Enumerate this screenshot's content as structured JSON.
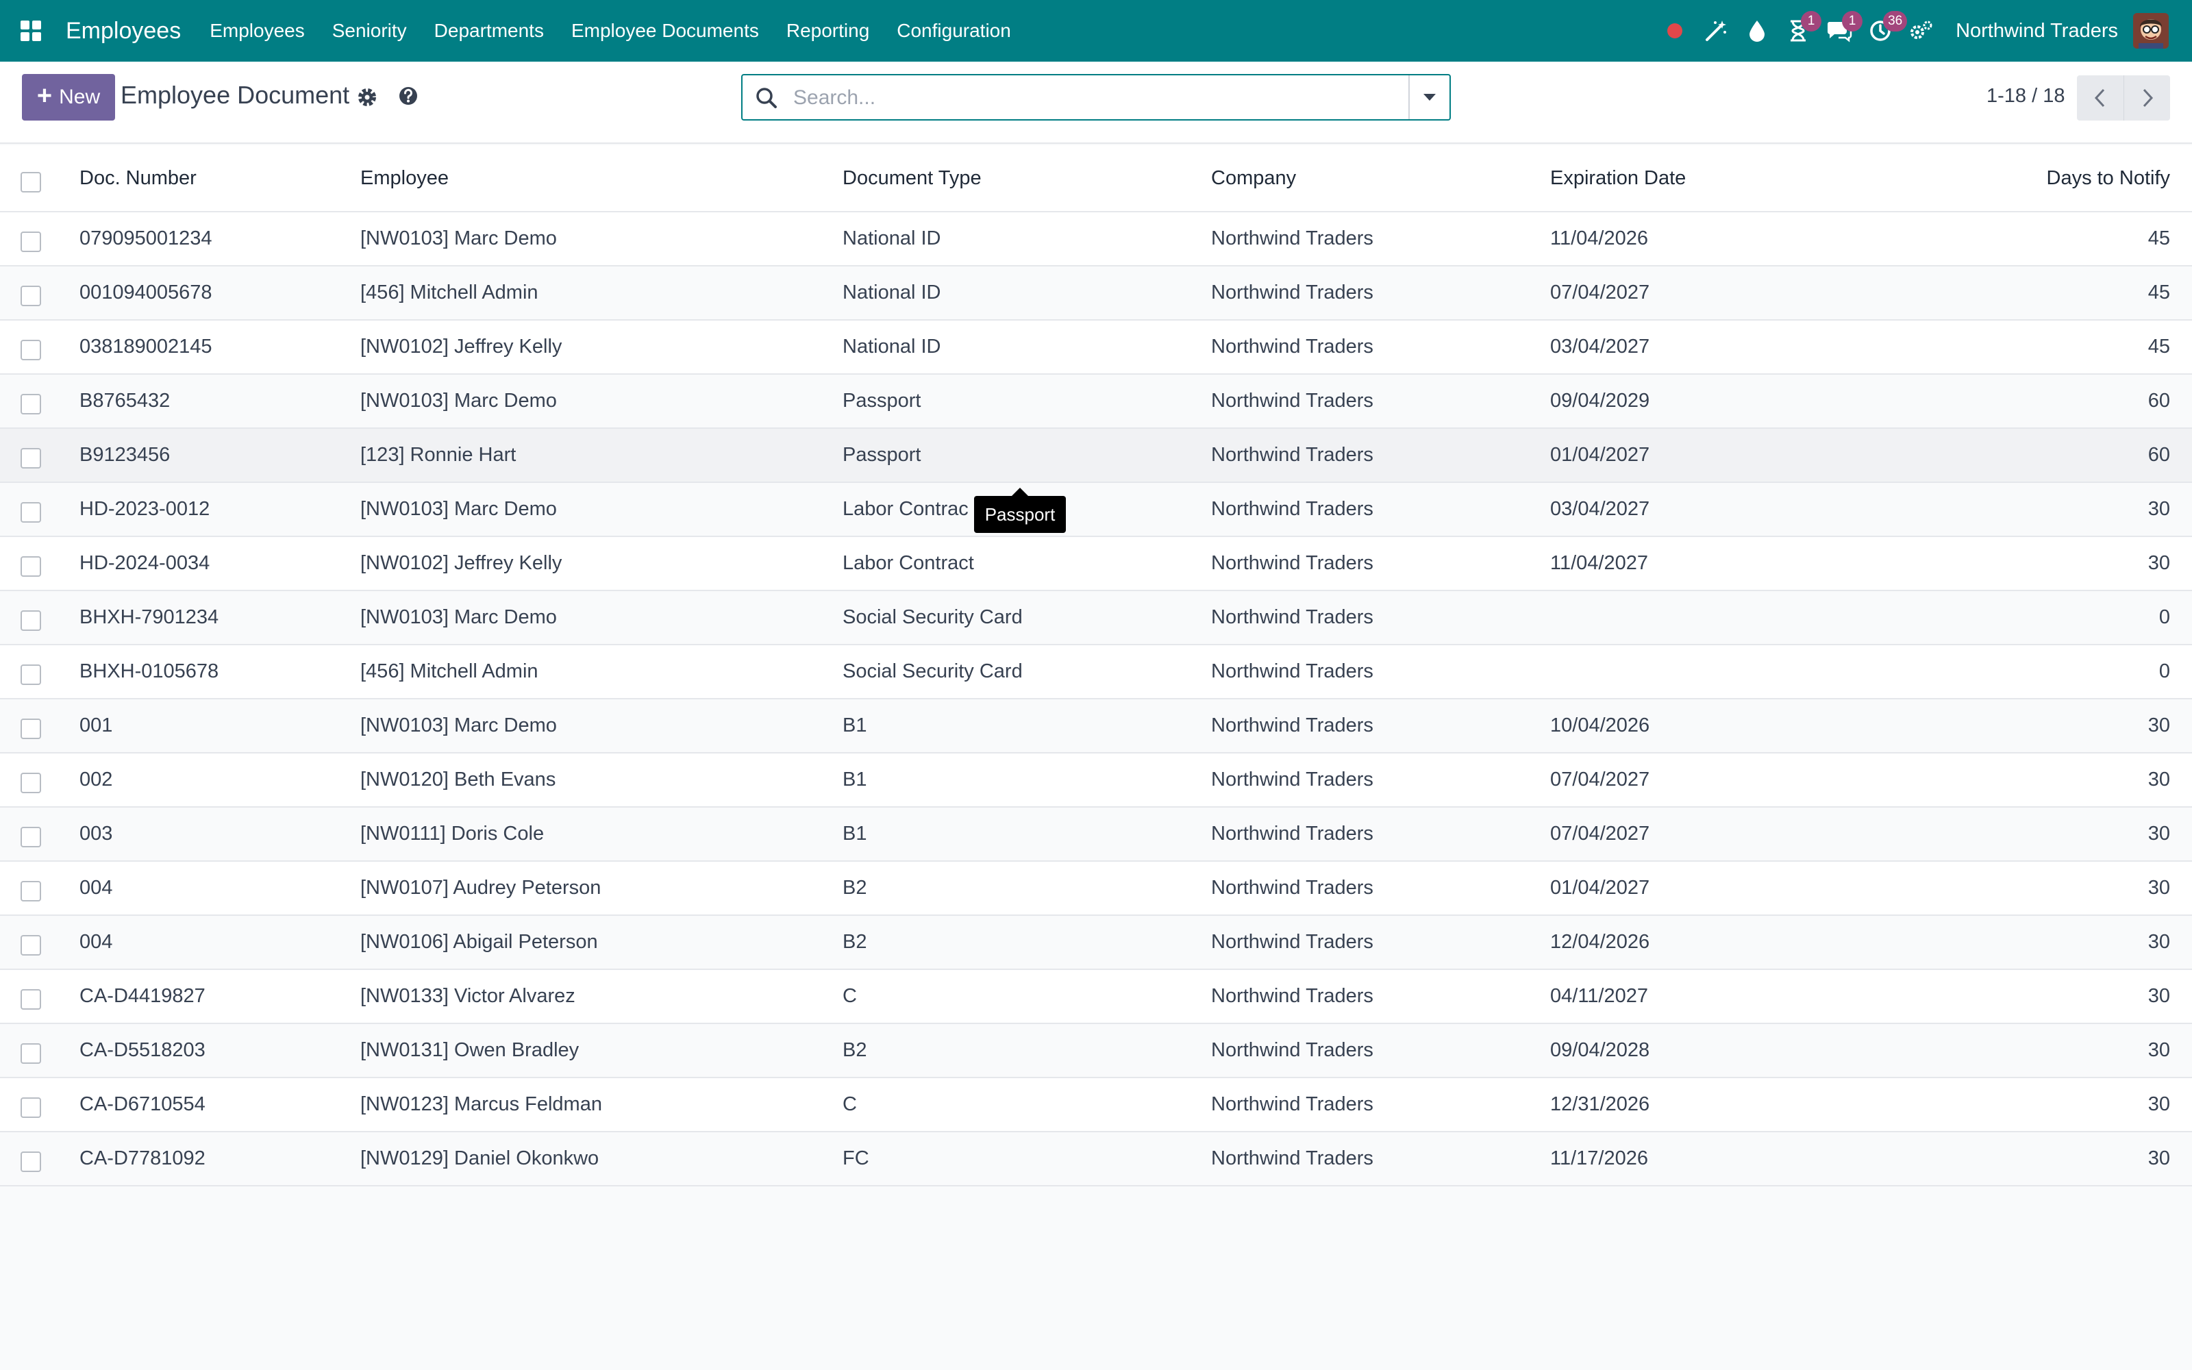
{
  "navbar": {
    "brand": "Employees",
    "menu": [
      "Employees",
      "Seniority",
      "Departments",
      "Employee Documents",
      "Reporting",
      "Configuration"
    ],
    "activities_count": "1",
    "messages_count": "1",
    "clock_count": "36",
    "company": "Northwind Traders",
    "colors": {
      "bar": "#017e84",
      "badge": "#a2457c",
      "recording_dot": "#e2474a"
    }
  },
  "control_panel": {
    "new_label": "New",
    "title": "Employee Document",
    "search_placeholder": "Search...",
    "pager": "1-18 / 18"
  },
  "table": {
    "columns": [
      "Doc. Number",
      "Employee",
      "Document Type",
      "Company",
      "Expiration Date",
      "Days to Notify"
    ],
    "rows": [
      {
        "doc": "079095001234",
        "employee": "[NW0103] Marc Demo",
        "type": "National ID",
        "company": "Northwind Traders",
        "expiration": "11/04/2026",
        "days": "45"
      },
      {
        "doc": "001094005678",
        "employee": "[456] Mitchell Admin",
        "type": "National ID",
        "company": "Northwind Traders",
        "expiration": "07/04/2027",
        "days": "45"
      },
      {
        "doc": "038189002145",
        "employee": "[NW0102] Jeffrey Kelly",
        "type": "National ID",
        "company": "Northwind Traders",
        "expiration": "03/04/2027",
        "days": "45"
      },
      {
        "doc": "B8765432",
        "employee": "[NW0103] Marc Demo",
        "type": "Passport",
        "company": "Northwind Traders",
        "expiration": "09/04/2029",
        "days": "60"
      },
      {
        "doc": "B9123456",
        "employee": "[123] Ronnie Hart",
        "type": "Passport",
        "company": "Northwind Traders",
        "expiration": "01/04/2027",
        "days": "60"
      },
      {
        "doc": "HD-2023-0012",
        "employee": "[NW0103] Marc Demo",
        "type": "Labor Contrac",
        "company": "Northwind Traders",
        "expiration": "03/04/2027",
        "days": "30"
      },
      {
        "doc": "HD-2024-0034",
        "employee": "[NW0102] Jeffrey Kelly",
        "type": "Labor Contract",
        "company": "Northwind Traders",
        "expiration": "11/04/2027",
        "days": "30"
      },
      {
        "doc": "BHXH-7901234",
        "employee": "[NW0103] Marc Demo",
        "type": "Social Security Card",
        "company": "Northwind Traders",
        "expiration": "",
        "days": "0"
      },
      {
        "doc": "BHXH-0105678",
        "employee": "[456] Mitchell Admin",
        "type": "Social Security Card",
        "company": "Northwind Traders",
        "expiration": "",
        "days": "0"
      },
      {
        "doc": "001",
        "employee": "[NW0103] Marc Demo",
        "type": "B1",
        "company": "Northwind Traders",
        "expiration": "10/04/2026",
        "days": "30"
      },
      {
        "doc": "002",
        "employee": "[NW0120] Beth Evans",
        "type": "B1",
        "company": "Northwind Traders",
        "expiration": "07/04/2027",
        "days": "30"
      },
      {
        "doc": "003",
        "employee": "[NW0111] Doris Cole",
        "type": "B1",
        "company": "Northwind Traders",
        "expiration": "07/04/2027",
        "days": "30"
      },
      {
        "doc": "004",
        "employee": "[NW0107] Audrey Peterson",
        "type": "B2",
        "company": "Northwind Traders",
        "expiration": "01/04/2027",
        "days": "30"
      },
      {
        "doc": "004",
        "employee": "[NW0106] Abigail Peterson",
        "type": "B2",
        "company": "Northwind Traders",
        "expiration": "12/04/2026",
        "days": "30"
      },
      {
        "doc": "CA-D4419827",
        "employee": "[NW0133] Victor Alvarez",
        "type": "C",
        "company": "Northwind Traders",
        "expiration": "04/11/2027",
        "days": "30"
      },
      {
        "doc": "CA-D5518203",
        "employee": "[NW0131] Owen Bradley",
        "type": "B2",
        "company": "Northwind Traders",
        "expiration": "09/04/2028",
        "days": "30"
      },
      {
        "doc": "CA-D6710554",
        "employee": "[NW0123] Marcus Feldman",
        "type": "C",
        "company": "Northwind Traders",
        "expiration": "12/31/2026",
        "days": "30"
      },
      {
        "doc": "CA-D7781092",
        "employee": "[NW0129] Daniel Okonkwo",
        "type": "FC",
        "company": "Northwind Traders",
        "expiration": "11/17/2026",
        "days": "30"
      }
    ]
  },
  "tooltip": {
    "text": "Passport"
  }
}
